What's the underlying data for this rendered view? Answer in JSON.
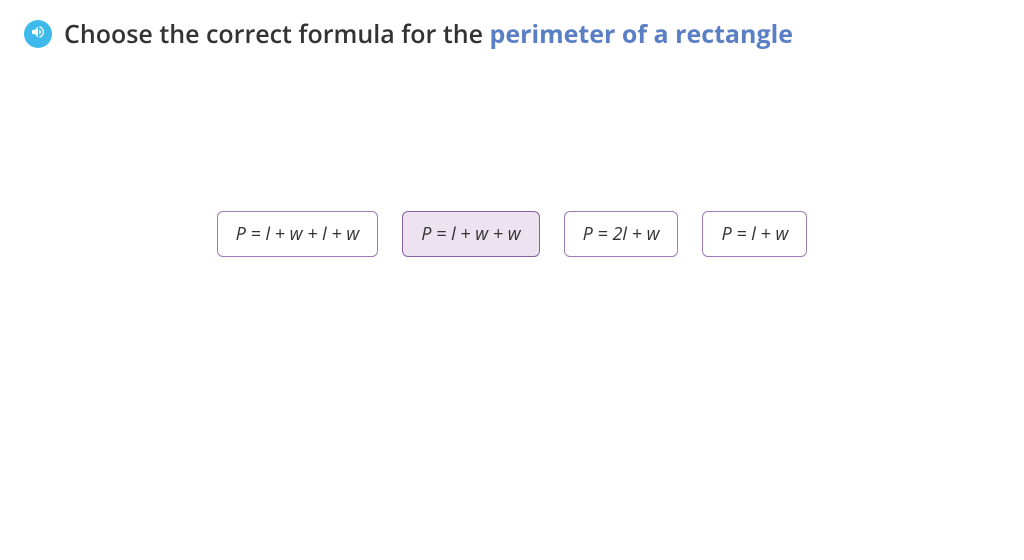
{
  "question": {
    "prefix": "Choose the correct formula for the ",
    "highlight": "perimeter of a rectangle"
  },
  "options": [
    {
      "formula": "P = l + w + l + w",
      "selected": false
    },
    {
      "formula": "P = l + w + w",
      "selected": true
    },
    {
      "formula": "P = 2l + w",
      "selected": false
    },
    {
      "formula": "P = l + w",
      "selected": false
    }
  ]
}
